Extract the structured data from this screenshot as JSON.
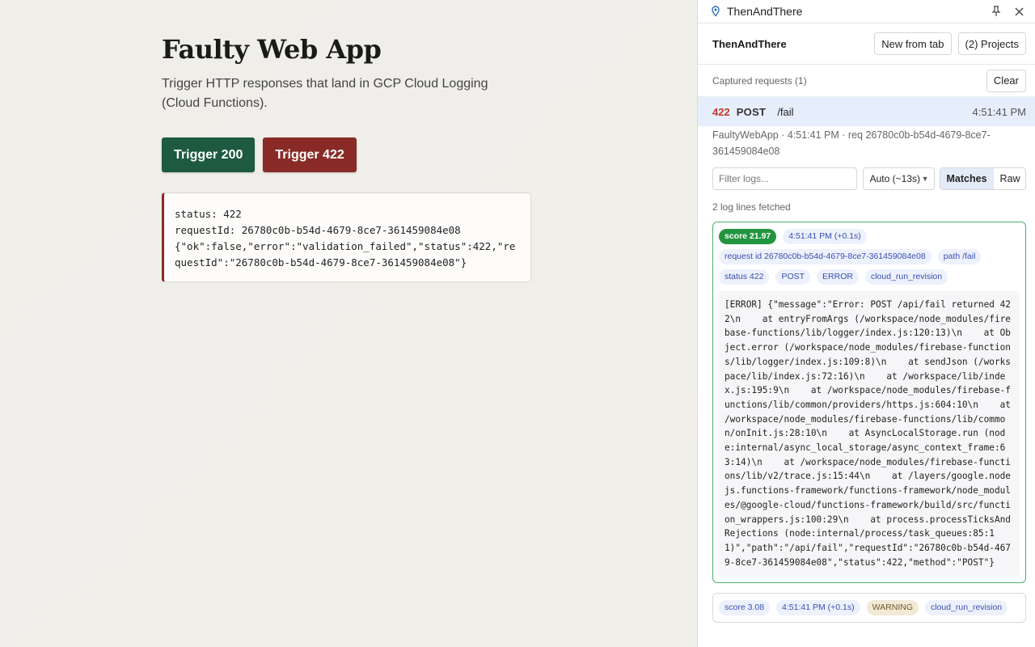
{
  "main": {
    "title": "Faulty Web App",
    "subtitle": "Trigger HTTP responses that land in GCP Cloud Logging (Cloud Functions).",
    "buttons": {
      "trigger_200": "Trigger 200",
      "trigger_422": "Trigger 422"
    },
    "result": "status: 422\nrequestId: 26780c0b-b54d-4679-8ce7-361459084e08\n{\"ok\":false,\"error\":\"validation_failed\",\"status\":422,\"requestId\":\"26780c0b-b54d-4679-8ce7-361459084e08\"}"
  },
  "panel": {
    "app_name": "ThenAndThere",
    "icons": {
      "location": "map-pin-icon",
      "pin": "pushpin-icon",
      "close": "close-icon"
    },
    "header": {
      "brand": "ThenAndThere",
      "new_from_tab": "New from tab",
      "projects": "(2) Projects"
    },
    "captured": {
      "caption": "Captured requests (1)",
      "clear": "Clear"
    },
    "request": {
      "status": "422",
      "method": "POST",
      "path": "/fail",
      "time": "4:51:41 PM",
      "meta": "FaultyWebApp · 4:51:41 PM · req 26780c0b-b54d-4679-8ce7-361459084e08"
    },
    "filter": {
      "placeholder": "Filter logs...",
      "auto": "Auto (~13s)",
      "matches": "Matches",
      "raw": "Raw"
    },
    "fetched": "2 log lines fetched",
    "log1": {
      "score": "score 21.97",
      "time": "4:51:41 PM (+0.1s)",
      "tags": [
        "request id 26780c0b-b54d-4679-8ce7-361459084e08",
        "path /fail",
        "status 422",
        "POST",
        "ERROR",
        "cloud_run_revision"
      ],
      "body": "[ERROR] {\"message\":\"Error: POST /api/fail returned 422\\n    at entryFromArgs (/workspace/node_modules/firebase-functions/lib/logger/index.js:120:13)\\n    at Object.error (/workspace/node_modules/firebase-functions/lib/logger/index.js:109:8)\\n    at sendJson (/workspace/lib/index.js:72:16)\\n    at /workspace/lib/index.js:195:9\\n    at /workspace/node_modules/firebase-functions/lib/common/providers/https.js:604:10\\n    at /workspace/node_modules/firebase-functions/lib/common/onInit.js:28:10\\n    at AsyncLocalStorage.run (node:internal/async_local_storage/async_context_frame:63:14)\\n    at /workspace/node_modules/firebase-functions/lib/v2/trace.js:15:44\\n    at /layers/google.nodejs.functions-framework/functions-framework/node_modules/@google-cloud/functions-framework/build/src/function_wrappers.js:100:29\\n    at process.processTicksAndRejections (node:internal/process/task_queues:85:11)\",\"path\":\"/api/fail\",\"requestId\":\"26780c0b-b54d-4679-8ce7-361459084e08\",\"status\":422,\"method\":\"POST\"}"
    },
    "log2": {
      "score": "score 3.08",
      "time": "4:51:41 PM (+0.1s)",
      "tags": [
        "WARNING",
        "cloud_run_revision"
      ]
    }
  }
}
